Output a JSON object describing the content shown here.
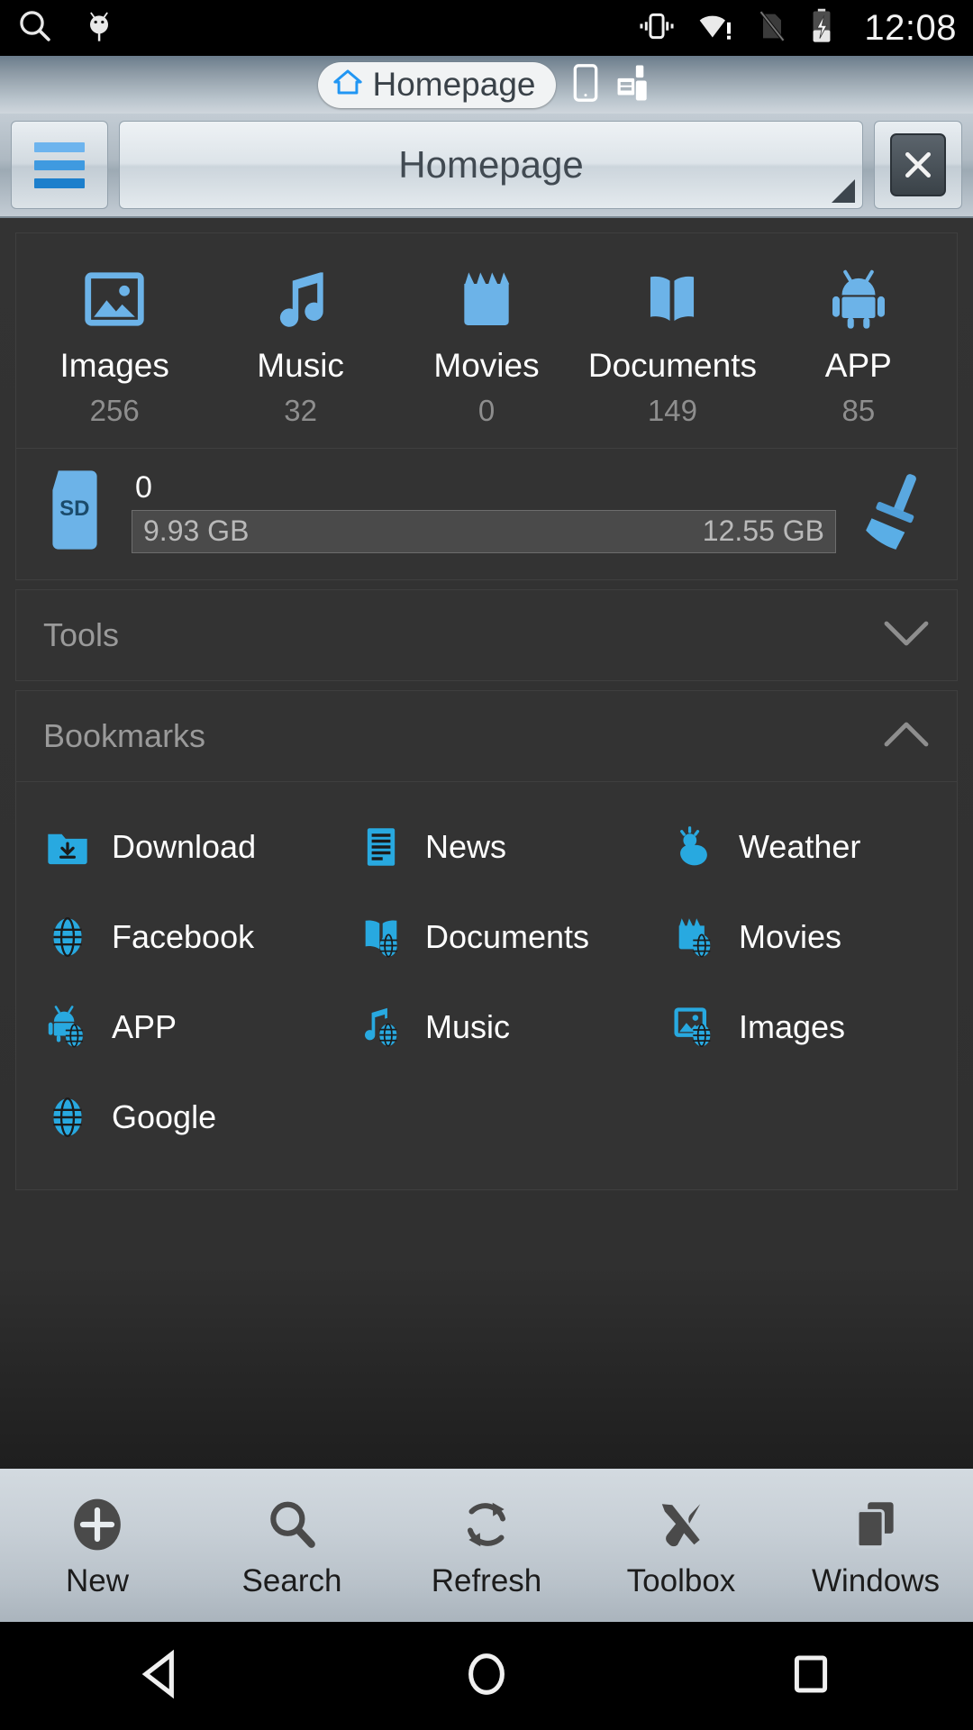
{
  "statusbar": {
    "left_icons": [
      "search-icon",
      "android-bug-icon"
    ],
    "right_icons": [
      "vibrate-icon",
      "wifi-no-internet-icon",
      "sim-missing-icon",
      "battery-charging-icon"
    ],
    "time": "12:08"
  },
  "tabstrip": {
    "tab_label": "Homepage",
    "tab_icon": "home-icon",
    "icons": [
      "tablet-icon",
      "remote-devices-icon"
    ]
  },
  "addressbar": {
    "menu_icon": "hamburger-menu-icon",
    "path_value": "Homepage",
    "path_placeholder": "Homepage",
    "close_label": "X"
  },
  "categories": [
    {
      "label": "Images",
      "count": "256",
      "icon": "image-icon"
    },
    {
      "label": "Music",
      "count": "32",
      "icon": "music-note-icon"
    },
    {
      "label": "Movies",
      "count": "0",
      "icon": "movie-clapper-icon"
    },
    {
      "label": "Documents",
      "count": "149",
      "icon": "book-icon"
    },
    {
      "label": "APP",
      "count": "85",
      "icon": "android-robot-icon"
    }
  ],
  "storage": {
    "card_icon": "sd-card-icon",
    "card_label": "SD",
    "free_label": "0",
    "used": "9.93 GB",
    "total": "12.55 GB",
    "used_percent": 0,
    "clean_icon": "broom-icon"
  },
  "sections": [
    {
      "title": "Tools",
      "expanded": false,
      "chevron": "chevron-down-icon"
    },
    {
      "title": "Bookmarks",
      "expanded": true,
      "chevron": "chevron-up-icon"
    }
  ],
  "bookmarks": [
    {
      "label": "Download",
      "icon": "folder-download-icon"
    },
    {
      "label": "News",
      "icon": "news-document-icon"
    },
    {
      "label": "Weather",
      "icon": "weather-cloud-icon"
    },
    {
      "label": "Facebook",
      "icon": "globe-icon"
    },
    {
      "label": "Documents",
      "icon": "book-globe-icon"
    },
    {
      "label": "Movies",
      "icon": "movie-globe-icon"
    },
    {
      "label": "APP",
      "icon": "android-globe-icon"
    },
    {
      "label": "Music",
      "icon": "music-globe-icon"
    },
    {
      "label": "Images",
      "icon": "image-globe-icon"
    },
    {
      "label": "Google",
      "icon": "globe-icon"
    }
  ],
  "toolbar": [
    {
      "label": "New",
      "icon": "plus-circle-icon"
    },
    {
      "label": "Search",
      "icon": "magnifier-icon"
    },
    {
      "label": "Refresh",
      "icon": "refresh-icon"
    },
    {
      "label": "Toolbox",
      "icon": "wrench-screwdriver-icon"
    },
    {
      "label": "Windows",
      "icon": "windows-stack-icon"
    }
  ],
  "navbar": [
    {
      "name": "back",
      "icon": "triangle-back-icon"
    },
    {
      "name": "home",
      "icon": "circle-home-icon"
    },
    {
      "name": "recents",
      "icon": "square-recents-icon"
    }
  ],
  "colors": {
    "accent_blue": "#6cb3e8",
    "bookmark_blue": "#28a9e0",
    "content_bg": "#333333",
    "card_border": "#3f3f3f",
    "label_white": "#ffffff",
    "muted_grey": "#8e8e8e"
  }
}
